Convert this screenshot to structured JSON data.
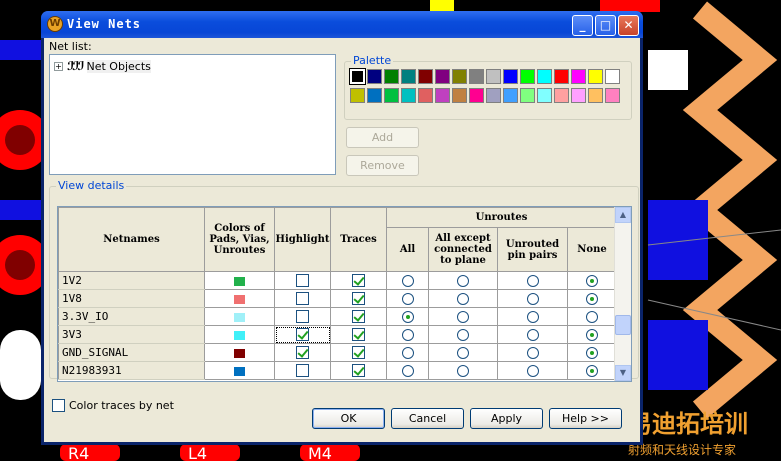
{
  "window": {
    "title": "View Nets"
  },
  "net_list": {
    "label": "Net list:",
    "root_item": "Net Objects"
  },
  "palette": {
    "label": "Palette",
    "row1": [
      "#000000",
      "#000080",
      "#008000",
      "#008080",
      "#800000",
      "#800080",
      "#808000",
      "#808080",
      "#c0c0c0",
      "#0000ff",
      "#00ff00",
      "#00ffff",
      "#ff0000",
      "#ff00ff",
      "#ffff00",
      "#ffffff"
    ],
    "row2": [
      "#c0c000",
      "#0070c0",
      "#00c040",
      "#00c0c0",
      "#e06060",
      "#c040c0",
      "#c08040",
      "#ff0090",
      "#a0a0c0",
      "#40a0ff",
      "#80ff80",
      "#80ffff",
      "#ffa0a0",
      "#ffa0ff",
      "#ffc060",
      "#ff80c0"
    ],
    "add_label": "Add",
    "remove_label": "Remove"
  },
  "view_details": {
    "label": "View details",
    "headers": {
      "netnames": "Netnames",
      "colors": "Colors of Pads, Vias, Unroutes",
      "highlight": "Highlight",
      "traces": "Traces",
      "unroutes": "Unroutes",
      "all": "All",
      "all_except": "All except connected to plane",
      "unrouted_pin_pairs": "Unrouted pin pairs",
      "none": "None"
    },
    "rows": [
      {
        "name": "1V2",
        "color": "#22b14c",
        "highlight": false,
        "traces": true,
        "unroute": "none"
      },
      {
        "name": "1V8",
        "color": "#f07070",
        "highlight": false,
        "traces": true,
        "unroute": "none"
      },
      {
        "name": "3.3V_IO",
        "color": "#a0f0f8",
        "highlight": false,
        "traces": true,
        "unroute": "all"
      },
      {
        "name": "3V3",
        "color": "#40f0f8",
        "highlight": true,
        "traces": true,
        "unroute": "none"
      },
      {
        "name": "GND_SIGNAL",
        "color": "#800000",
        "highlight": true,
        "traces": true,
        "unroute": "none"
      },
      {
        "name": "N21983931",
        "color": "#0070c0",
        "highlight": false,
        "traces": true,
        "unroute": "none"
      }
    ]
  },
  "color_traces_by_net": {
    "label": "Color traces by net",
    "checked": false
  },
  "buttons": {
    "ok": "OK",
    "cancel": "Cancel",
    "apply": "Apply",
    "help": "Help >>"
  },
  "background": {
    "watermark_text": "易迪拓培训",
    "watermark_sub": "射频和天线设计专家",
    "pcb_labels": [
      "R4",
      "L4",
      "M4"
    ]
  }
}
